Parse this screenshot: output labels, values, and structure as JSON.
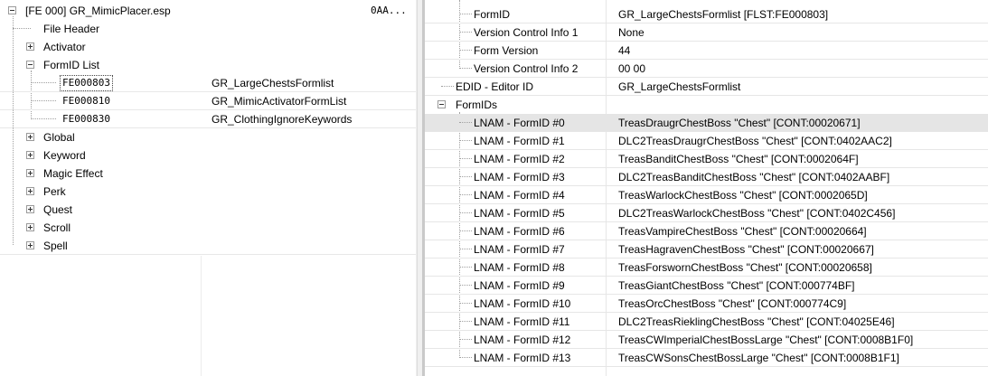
{
  "left": {
    "root": {
      "label": "[FE 000] GR_MimicPlacer.esp",
      "col2": "0AA..."
    },
    "items": [
      {
        "label": "File Header"
      },
      {
        "label": "Activator"
      },
      {
        "label": "FormID List"
      },
      {
        "label": "FE000803",
        "value": "GR_LargeChestsFormlist"
      },
      {
        "label": "FE000810",
        "value": "GR_MimicActivatorFormList"
      },
      {
        "label": "FE000830",
        "value": "GR_ClothingIgnoreKeywords"
      },
      {
        "label": "Global"
      },
      {
        "label": "Keyword"
      },
      {
        "label": "Magic Effect"
      },
      {
        "label": "Perk"
      },
      {
        "label": "Quest"
      },
      {
        "label": "Scroll"
      },
      {
        "label": "Spell"
      }
    ]
  },
  "right": {
    "header_rows": [
      {
        "label": "FormID",
        "value": "GR_LargeChestsFormlist [FLST:FE000803]"
      },
      {
        "label": "Version Control Info 1",
        "value": "None"
      },
      {
        "label": "Form Version",
        "value": "44"
      },
      {
        "label": "Version Control Info 2",
        "value": "00 00"
      }
    ],
    "edid": {
      "label": "EDID - Editor ID",
      "value": "GR_LargeChestsFormlist"
    },
    "formids_label": "FormIDs",
    "lnam_rows": [
      {
        "label": "LNAM - FormID #0",
        "value": "TreasDraugrChestBoss \"Chest\" [CONT:00020671]"
      },
      {
        "label": "LNAM - FormID #1",
        "value": "DLC2TreasDraugrChestBoss \"Chest\" [CONT:0402AAC2]"
      },
      {
        "label": "LNAM - FormID #2",
        "value": "TreasBanditChestBoss \"Chest\" [CONT:0002064F]"
      },
      {
        "label": "LNAM - FormID #3",
        "value": "DLC2TreasBanditChestBoss \"Chest\" [CONT:0402AABF]"
      },
      {
        "label": "LNAM - FormID #4",
        "value": "TreasWarlockChestBoss \"Chest\" [CONT:0002065D]"
      },
      {
        "label": "LNAM - FormID #5",
        "value": "DLC2TreasWarlockChestBoss \"Chest\" [CONT:0402C456]"
      },
      {
        "label": "LNAM - FormID #6",
        "value": "TreasVampireChestBoss \"Chest\" [CONT:00020664]"
      },
      {
        "label": "LNAM - FormID #7",
        "value": "TreasHagravenChestBoss \"Chest\" [CONT:00020667]"
      },
      {
        "label": "LNAM - FormID #8",
        "value": "TreasForswornChestBoss \"Chest\" [CONT:00020658]"
      },
      {
        "label": "LNAM - FormID #9",
        "value": "TreasGiantChestBoss \"Chest\" [CONT:000774BF]"
      },
      {
        "label": "LNAM - FormID #10",
        "value": "TreasOrcChestBoss \"Chest\" [CONT:000774C9]"
      },
      {
        "label": "LNAM - FormID #11",
        "value": "DLC2TreasRieklingChestBoss \"Chest\" [CONT:04025E46]"
      },
      {
        "label": "LNAM - FormID #12",
        "value": "TreasCWImperialChestBossLarge \"Chest\" [CONT:0008B1F0]"
      },
      {
        "label": "LNAM - FormID #13",
        "value": "TreasCWSonsChestBossLarge \"Chest\" [CONT:0008B1F1]"
      }
    ]
  }
}
